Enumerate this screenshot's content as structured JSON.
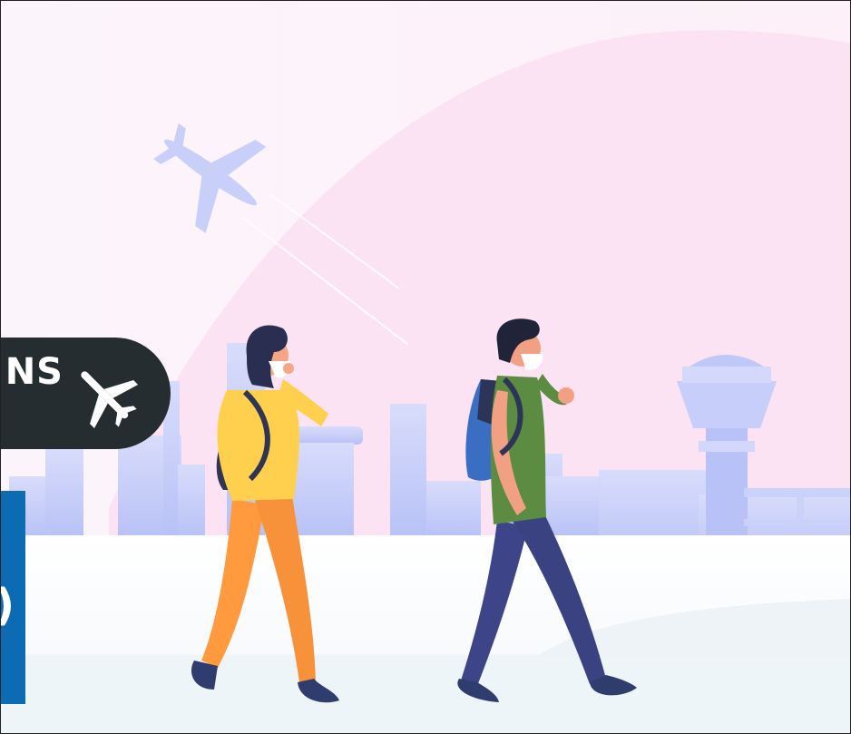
{
  "banner": {
    "text": "NS",
    "icon": "airplane-icon"
  },
  "info_panel": {
    "text": ")"
  },
  "illustration": {
    "subjects": [
      "woman-traveler",
      "man-traveler",
      "airplane",
      "control-tower",
      "city-skyline"
    ],
    "colors": {
      "sky": "#fdf0f8",
      "hill": "#fbe3f3",
      "skyline": "#c6cdf9",
      "banner": "#262d31",
      "panel": "#0c6bb3",
      "ground": "#eef5f8"
    }
  }
}
